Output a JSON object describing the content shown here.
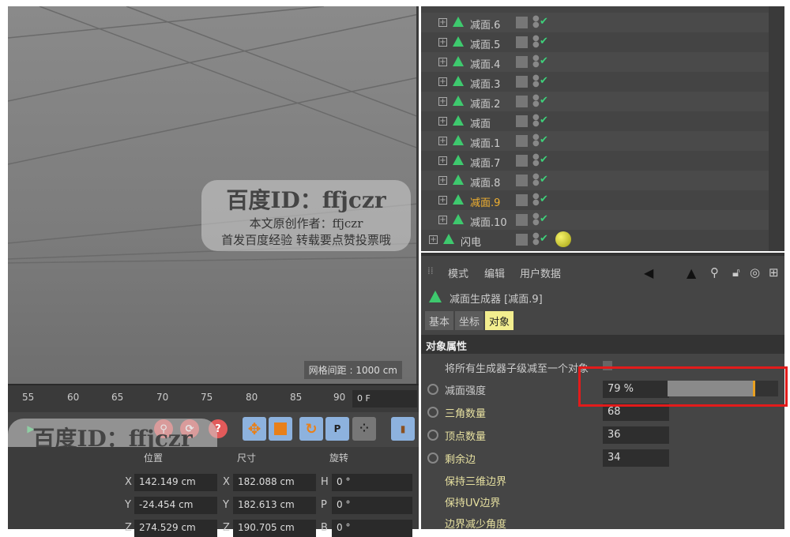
{
  "viewport": {
    "grid_label": "网格间距 : 1000 cm"
  },
  "timeline": {
    "ticks": [
      "55",
      "60",
      "65",
      "70",
      "75",
      "80",
      "85",
      "90"
    ],
    "frame": "0 F"
  },
  "toolbar": {
    "help": "?",
    "param": "P"
  },
  "coords": {
    "headers": [
      "位置",
      "尺寸",
      "旋转"
    ],
    "rows": [
      {
        "axis": "X",
        "pos": "142.149 cm",
        "size_axis": "X",
        "size": "182.088 cm",
        "rot_axis": "H",
        "rot": "0 °"
      },
      {
        "axis": "Y",
        "pos": "-24.454 cm",
        "size_axis": "Y",
        "size": "182.613 cm",
        "rot_axis": "P",
        "rot": "0 °"
      },
      {
        "axis": "Z",
        "pos": "274.529 cm",
        "size_axis": "Z",
        "size": "190.705 cm",
        "rot_axis": "B",
        "rot": "0 °"
      }
    ]
  },
  "objects": [
    {
      "name": "减面.6"
    },
    {
      "name": "减面.5"
    },
    {
      "name": "减面.4"
    },
    {
      "name": "减面.3"
    },
    {
      "name": "减面.2"
    },
    {
      "name": "减面"
    },
    {
      "name": "减面.1"
    },
    {
      "name": "减面.7"
    },
    {
      "name": "减面.8"
    },
    {
      "name": "减面.9",
      "selected": true
    },
    {
      "name": "减面.10"
    },
    {
      "name": "闪电"
    }
  ],
  "attributes": {
    "menu": [
      "模式",
      "编辑",
      "用户数据"
    ],
    "title": "减面生成器 [减面.9]",
    "tabs": [
      "基本",
      "坐标",
      "对象"
    ],
    "active_tab": "对象",
    "section": "对象属性",
    "reduce_all": "将所有生成器子级减至一个对象",
    "params": [
      {
        "label": "减面强度",
        "value": "79 %"
      },
      {
        "label": "三角数量",
        "value": "68"
      },
      {
        "label": "顶点数量",
        "value": "36"
      },
      {
        "label": "剩余边",
        "value": "34"
      }
    ],
    "options": [
      "保持三维边界",
      "保持UV边界",
      "边界减少角度"
    ],
    "strength_fraction": 0.79
  },
  "watermark": {
    "id": "百度ID：ffjczr",
    "author": "本文原创作者：ffjczr",
    "note": "首发百度经验  转载要点赞投票哦"
  },
  "colors": {
    "accent": "#e8a020",
    "selected": "#f0b030",
    "highlight": "#e21b1b"
  }
}
